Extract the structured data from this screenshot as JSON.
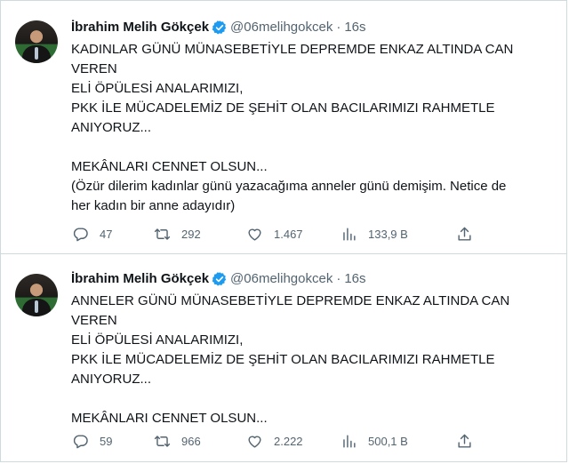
{
  "tweets": [
    {
      "author": {
        "name": "İbrahim Melih Gökçek",
        "handle": "@06melihgokcek",
        "separator": "·",
        "time": "16s"
      },
      "text": "KADINLAR GÜNÜ MÜNASEBETİYLE DEPREMDE ENKAZ ALTINDA CAN\nVEREN\nELİ ÖPÜLESİ ANALARIMIZI,\nPKK İLE MÜCADELEMİZ DE ŞEHİT OLAN BACILARIMIZI RAHMETLE\nANIYORUZ...\n\nMEKÂNLARI CENNET OLSUN...\n(Özür dilerim kadınlar günü yazacağıma anneler günü demişim. Netice de\nher kadın bir anne adayıdır)",
      "stats": {
        "replies": "47",
        "retweets": "292",
        "likes": "1.467",
        "views": "133,9 B"
      }
    },
    {
      "author": {
        "name": "İbrahim Melih Gökçek",
        "handle": "@06melihgokcek",
        "separator": "·",
        "time": "16s"
      },
      "text": "ANNELER GÜNÜ MÜNASEBETİYLE DEPREMDE ENKAZ ALTINDA CAN\nVEREN\nELİ ÖPÜLESİ ANALARIMIZI,\nPKK İLE MÜCADELEMİZ DE ŞEHİT OLAN BACILARIMIZI RAHMETLE\nANIYORUZ...\n\nMEKÂNLARI CENNET OLSUN...",
      "stats": {
        "replies": "59",
        "retweets": "966",
        "likes": "2.222",
        "views": "500,1 B"
      }
    }
  ],
  "icons": {
    "verified": "verified-badge-icon",
    "reply": "reply-icon",
    "retweet": "retweet-icon",
    "like": "heart-icon",
    "views": "views-chart-icon",
    "share": "share-icon"
  },
  "colors": {
    "text": "#0f1419",
    "secondary": "#536471",
    "verified": "#1d9bf0",
    "border": "#cfd9de"
  }
}
